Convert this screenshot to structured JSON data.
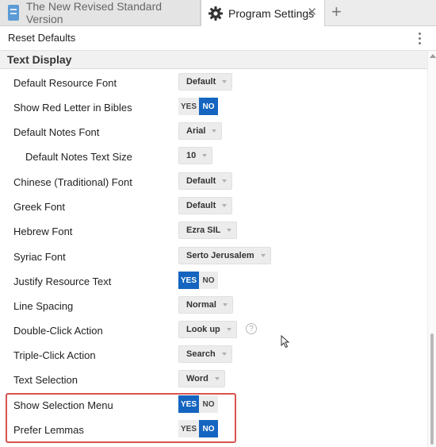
{
  "tabs": {
    "inactive_title": "The New Revised Standard Version",
    "active_title": "Program Settings",
    "close_symbol": "✕",
    "new_tab_symbol": "+"
  },
  "toolbar": {
    "reset_label": "Reset Defaults",
    "more_icon": "kebab-vertical-icon"
  },
  "section": {
    "title": "Text Display"
  },
  "settings": [
    {
      "label": "Default Resource Font",
      "type": "dropdown",
      "value": "Default"
    },
    {
      "label": "Show Red Letter in Bibles",
      "type": "toggle",
      "yes": "YES",
      "no": "NO",
      "selected": "no"
    },
    {
      "label": "Default Notes Font",
      "type": "dropdown",
      "value": "Arial"
    },
    {
      "label": "Default Notes Text Size",
      "type": "dropdown",
      "value": "10",
      "indent": true
    },
    {
      "label": "Chinese (Traditional) Font",
      "type": "dropdown",
      "value": "Default"
    },
    {
      "label": "Greek Font",
      "type": "dropdown",
      "value": "Default"
    },
    {
      "label": "Hebrew Font",
      "type": "dropdown",
      "value": "Ezra SIL"
    },
    {
      "label": "Syriac Font",
      "type": "dropdown",
      "value": "Serto Jerusalem"
    },
    {
      "label": "Justify Resource Text",
      "type": "toggle",
      "yes": "YES",
      "no": "NO",
      "selected": "yes"
    },
    {
      "label": "Line Spacing",
      "type": "dropdown",
      "value": "Normal"
    },
    {
      "label": "Double-Click Action",
      "type": "dropdown",
      "value": "Look up",
      "help": "?"
    },
    {
      "label": "Triple-Click Action",
      "type": "dropdown",
      "value": "Search"
    },
    {
      "label": "Text Selection",
      "type": "dropdown",
      "value": "Word"
    },
    {
      "label": "Show Selection Menu",
      "type": "toggle",
      "yes": "YES",
      "no": "NO",
      "selected": "yes"
    },
    {
      "label": "Prefer Lemmas",
      "type": "toggle",
      "yes": "YES",
      "no": "NO",
      "selected": "no"
    }
  ],
  "colors": {
    "accent": "#1565c0",
    "highlight_border": "#d9534f"
  }
}
